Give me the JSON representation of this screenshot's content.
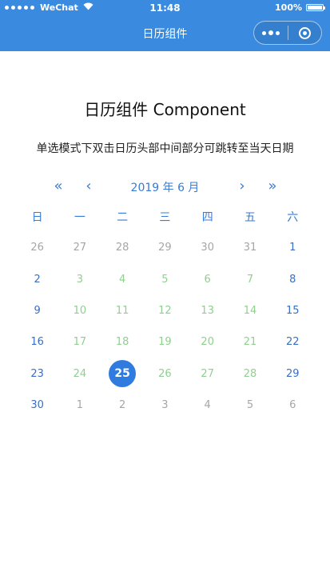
{
  "status_bar": {
    "carrier": "WeChat",
    "time": "11:48",
    "battery": "100%"
  },
  "nav_bar": {
    "title": "日历组件"
  },
  "page": {
    "heading": "日历组件 Component",
    "subtitle": "单选模式下双击日历头部中间部分可跳转至当天日期"
  },
  "calendar": {
    "prev_year": "«",
    "prev_month": "‹",
    "month_label": "2019 年 6 月",
    "next_month": "›",
    "next_year": "»",
    "weekdays": [
      "日",
      "一",
      "二",
      "三",
      "四",
      "五",
      "六"
    ],
    "selected": "25",
    "weeks": [
      [
        "26",
        "27",
        "28",
        "29",
        "30",
        "31",
        "1"
      ],
      [
        "2",
        "3",
        "4",
        "5",
        "6",
        "7",
        "8"
      ],
      [
        "9",
        "10",
        "11",
        "12",
        "13",
        "14",
        "15"
      ],
      [
        "16",
        "17",
        "18",
        "19",
        "20",
        "21",
        "22"
      ],
      [
        "23",
        "24",
        "25",
        "26",
        "27",
        "28",
        "29"
      ],
      [
        "30",
        "1",
        "2",
        "3",
        "4",
        "5",
        "6"
      ]
    ]
  }
}
